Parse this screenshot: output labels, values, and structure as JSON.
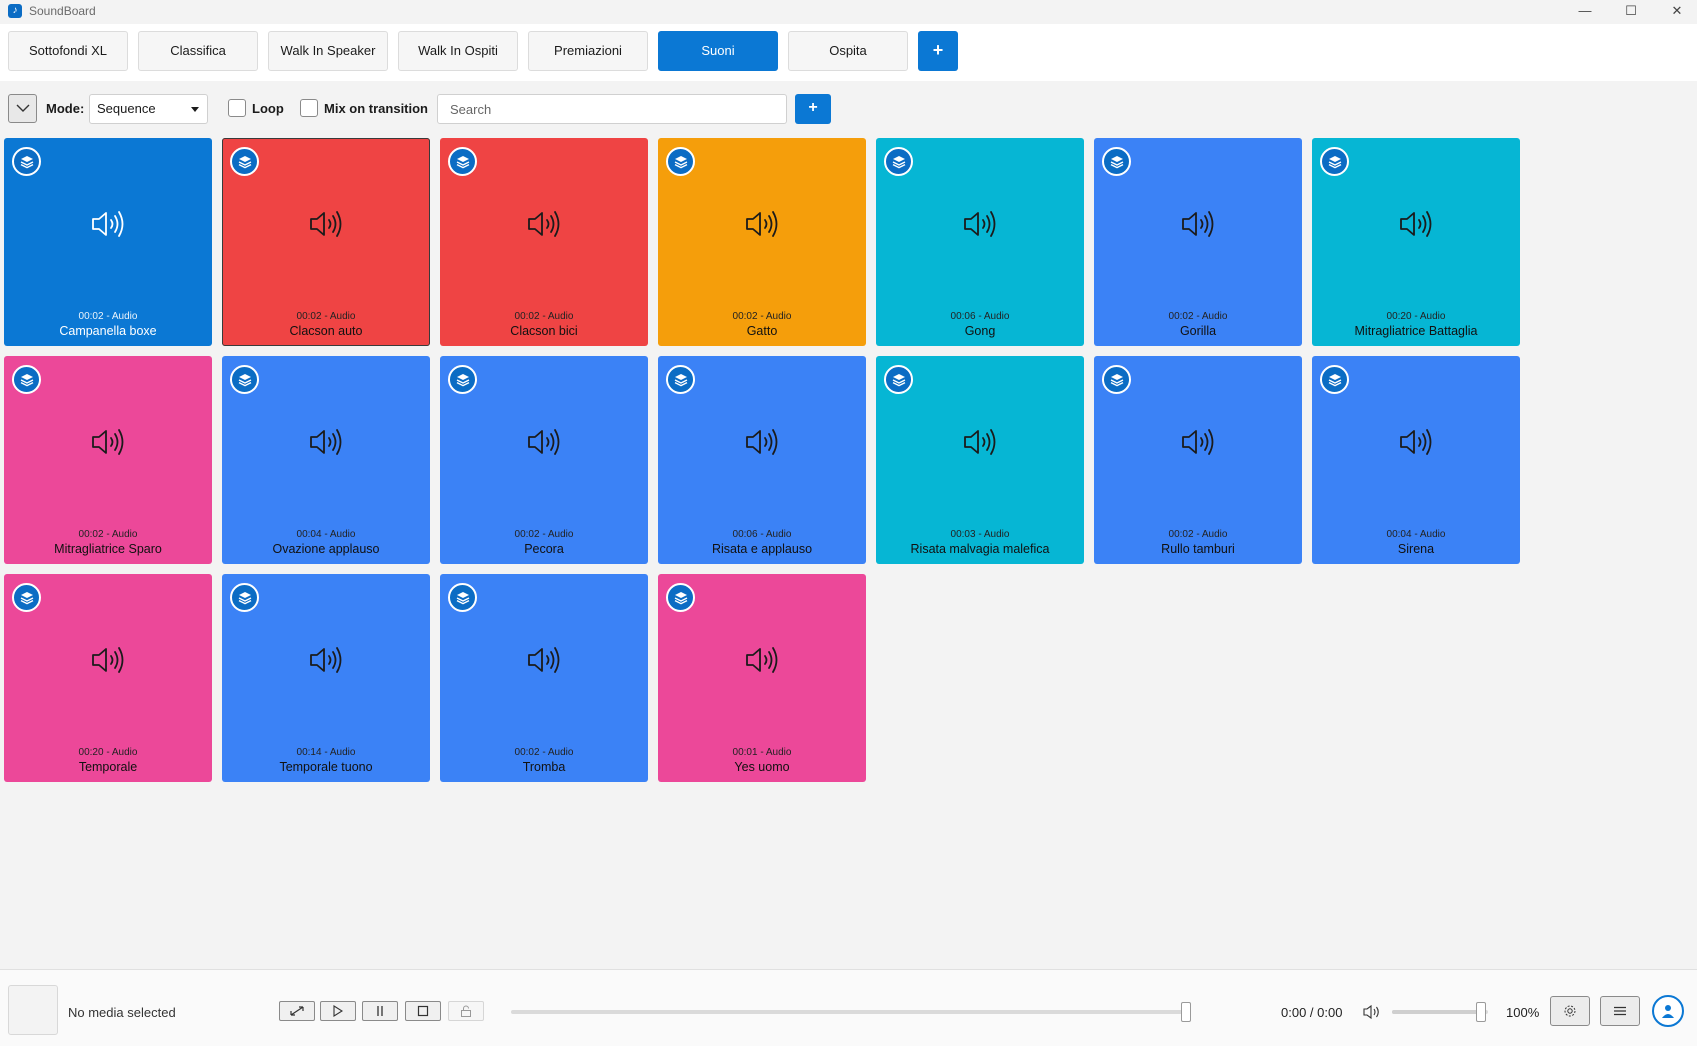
{
  "window": {
    "title": "SoundBoard"
  },
  "tabs": [
    {
      "label": "Sottofondi XL",
      "active": false
    },
    {
      "label": "Classifica",
      "active": false
    },
    {
      "label": "Walk In Speaker",
      "active": false
    },
    {
      "label": "Walk In Ospiti",
      "active": false
    },
    {
      "label": "Premiazioni",
      "active": false
    },
    {
      "label": "Suoni",
      "active": true
    },
    {
      "label": "Ospita",
      "active": false
    }
  ],
  "tab_add_label": "+",
  "toolbar": {
    "mode_label": "Mode:",
    "mode_value": "Sequence",
    "loop_label": "Loop",
    "mix_label": "Mix on transition",
    "search_placeholder": "Search",
    "add_label": "+"
  },
  "sounds": [
    {
      "name": "Campanella boxe",
      "meta": "00:02 - Audio",
      "color": "#0b78d4",
      "dark": true
    },
    {
      "name": "Clacson auto",
      "meta": "00:02 - Audio",
      "color": "#ef4444",
      "dark": false,
      "selected": true
    },
    {
      "name": "Clacson bici",
      "meta": "00:02 - Audio",
      "color": "#ef4444",
      "dark": false
    },
    {
      "name": "Gatto",
      "meta": "00:02 - Audio",
      "color": "#f59e0b",
      "dark": false
    },
    {
      "name": "Gong",
      "meta": "00:06 - Audio",
      "color": "#06b6d4",
      "dark": false
    },
    {
      "name": "Gorilla",
      "meta": "00:02 - Audio",
      "color": "#3b82f6",
      "dark": false
    },
    {
      "name": "Mitragliatrice Battaglia",
      "meta": "00:20 - Audio",
      "color": "#06b6d4",
      "dark": false
    },
    {
      "name": "Mitragliatrice Sparo",
      "meta": "00:02 - Audio",
      "color": "#ec4899",
      "dark": false
    },
    {
      "name": "Ovazione applauso",
      "meta": "00:04 - Audio",
      "color": "#3b82f6",
      "dark": false
    },
    {
      "name": "Pecora",
      "meta": "00:02 - Audio",
      "color": "#3b82f6",
      "dark": false
    },
    {
      "name": "Risata e applauso",
      "meta": "00:06 - Audio",
      "color": "#3b82f6",
      "dark": false
    },
    {
      "name": "Risata malvagia malefica",
      "meta": "00:03 - Audio",
      "color": "#06b6d4",
      "dark": false
    },
    {
      "name": "Rullo tamburi",
      "meta": "00:02 - Audio",
      "color": "#3b82f6",
      "dark": false
    },
    {
      "name": "Sirena",
      "meta": "00:04 - Audio",
      "color": "#3b82f6",
      "dark": false
    },
    {
      "name": "Temporale",
      "meta": "00:20 - Audio",
      "color": "#ec4899",
      "dark": false
    },
    {
      "name": "Temporale tuono",
      "meta": "00:14 - Audio",
      "color": "#3b82f6",
      "dark": false
    },
    {
      "name": "Tromba",
      "meta": "00:02 - Audio",
      "color": "#3b82f6",
      "dark": false
    },
    {
      "name": "Yes uomo",
      "meta": "00:01 - Audio",
      "color": "#ec4899",
      "dark": false
    }
  ],
  "player": {
    "now_playing": "No media selected",
    "time": "0:00 / 0:00",
    "volume": "100%",
    "seek_fraction": 1.0,
    "volume_fraction": 1.0
  }
}
